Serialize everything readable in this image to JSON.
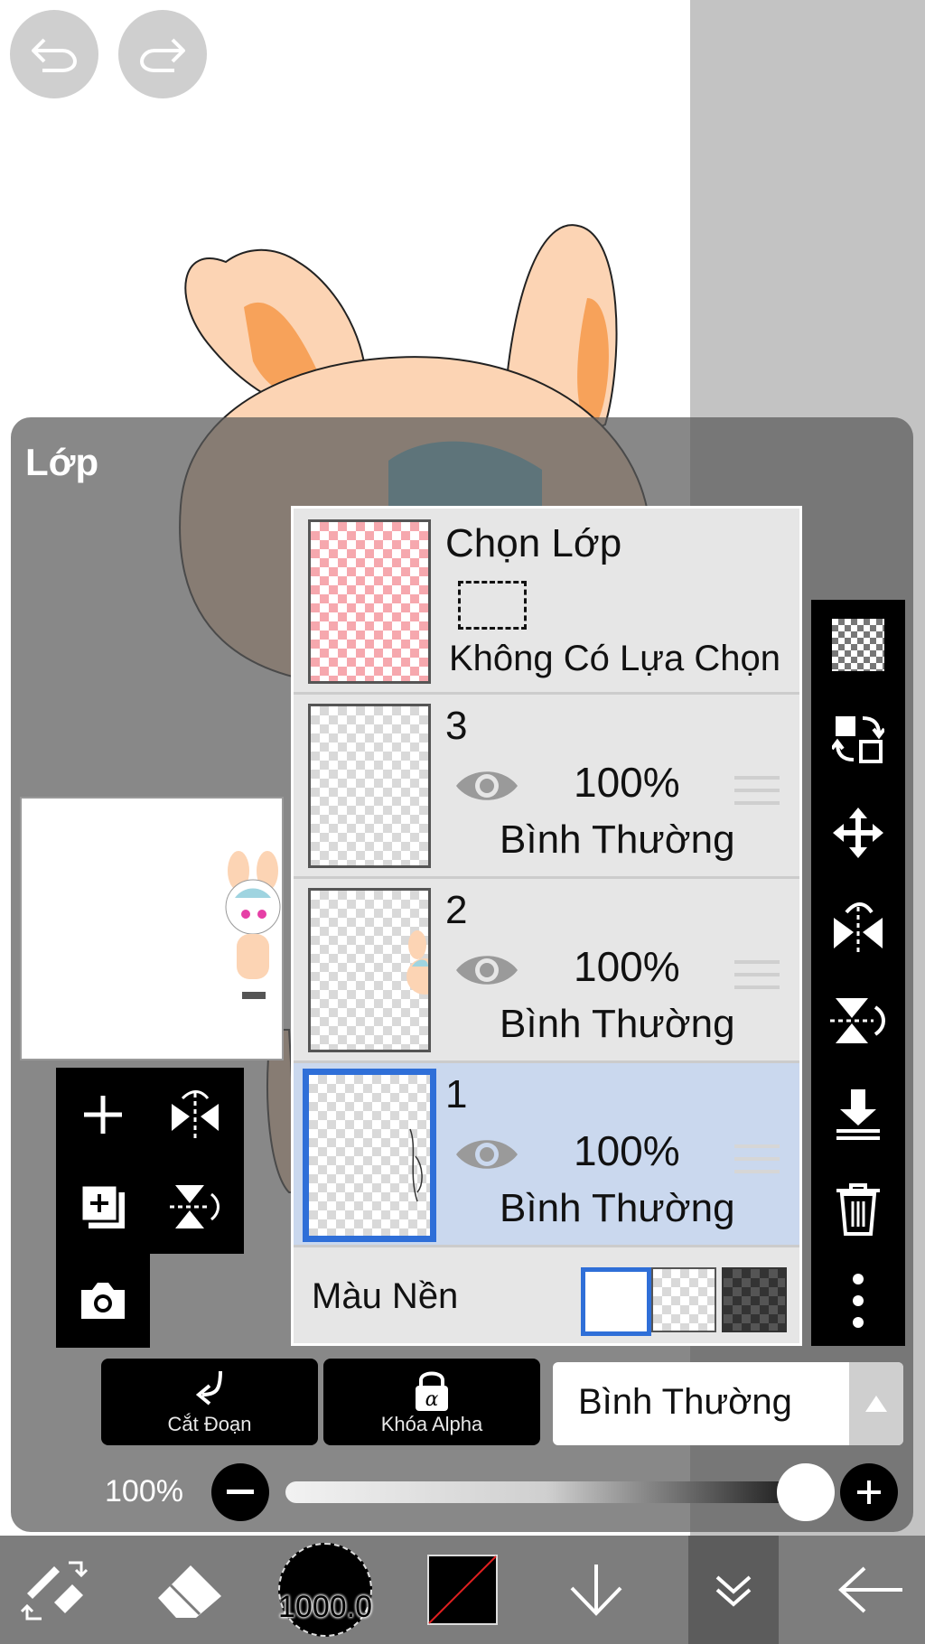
{
  "panel": {
    "title": "Lớp"
  },
  "selection_layer": {
    "title": "Chọn Lớp",
    "status": "Không Có Lựa Chọn"
  },
  "layers": [
    {
      "number": "3",
      "opacity": "100%",
      "mode": "Bình Thường",
      "visible": true,
      "selected": false
    },
    {
      "number": "2",
      "opacity": "100%",
      "mode": "Bình Thường",
      "visible": true,
      "selected": false
    },
    {
      "number": "1",
      "opacity": "100%",
      "mode": "Bình Thường",
      "visible": true,
      "selected": true
    }
  ],
  "background": {
    "label": "Màu Nền",
    "options": [
      "white",
      "transparent",
      "dark-checker"
    ],
    "selected": "white"
  },
  "actions": {
    "clip_label": "Cắt Đoạn",
    "alpha_lock_label": "Khóa Alpha"
  },
  "blend_mode": {
    "value": "Bình Thường"
  },
  "opacity": {
    "label": "100%",
    "value": 1.0
  },
  "toolbar": {
    "brush_size": "1000.0"
  },
  "colors": {
    "accent": "#2f6fd8",
    "selected_row": "#cad8ee",
    "panel": "#5a5a5a"
  }
}
